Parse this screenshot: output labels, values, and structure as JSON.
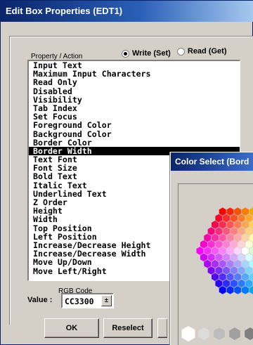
{
  "window": {
    "title": "Edit Box Properties (EDT1)"
  },
  "property_list": {
    "caption": "Property / Action",
    "selected_index": 10,
    "items": [
      "Input Text",
      "Maximum Input Characters",
      "Read Only",
      "Disabled",
      "Visibility",
      "Tab Index",
      "Set Focus",
      "Foreground Color",
      "Background Color",
      "Border Color",
      "Border Width",
      "Text Font",
      "Font Size",
      "Bold Text",
      "Italic Text",
      "Underlined Text",
      "Z Order",
      "Height",
      "Width",
      "Top Position",
      "Left Position",
      "Increase/Decrease Height",
      "Increase/Decrease Width",
      "Move Up/Down",
      "Move Left/Right"
    ]
  },
  "mode": {
    "write_label": "Write (Set)",
    "read_label": "Read (Get)",
    "selected": "write"
  },
  "value": {
    "caption": "RGB Code",
    "label": "Value :",
    "text": "CC3300"
  },
  "buttons": {
    "ok": "OK",
    "reselect": "Reselect"
  },
  "color_dialog": {
    "title": "Color Select (Bord"
  }
}
